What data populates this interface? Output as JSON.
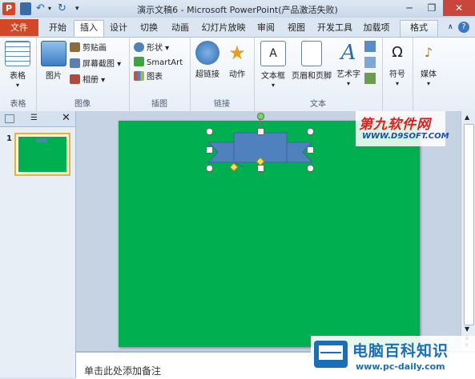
{
  "window": {
    "title": "演示文稿6 - Microsoft PowerPoint(产品激活失败)"
  },
  "tabs": [
    "开始",
    "插入",
    "设计",
    "切换",
    "动画",
    "幻灯片放映",
    "审阅",
    "视图",
    "开发工具",
    "加载项"
  ],
  "file_tab": "文件",
  "format_tab": "格式",
  "ribbon": {
    "table": {
      "label": "表格",
      "group": "表格"
    },
    "image_group": {
      "picture": "图片",
      "clipart": "剪贴画",
      "screenshot": "屏幕截图",
      "album": "相册",
      "group": "图像"
    },
    "illustration_group": {
      "shapes": "形状",
      "smartart": "SmartArt",
      "chart": "图表",
      "group": "插图"
    },
    "link_group": {
      "hyperlink": "超链接",
      "action": "动作",
      "group": "链接"
    },
    "text_group": {
      "textbox": "文本框",
      "header_footer": "页眉和页脚",
      "wordart": "艺术字",
      "group": "文本"
    },
    "symbol": {
      "label": "符号"
    },
    "media": {
      "label": "媒体"
    }
  },
  "slide_panel": {
    "slide_number": "1"
  },
  "notes": {
    "placeholder": "单击此处添加备注"
  },
  "watermarks": {
    "top_cn": "第九软件网",
    "top_url": "WWW.D9SOFT.COM",
    "bottom_cn": "电脑百科知识",
    "bottom_url": "www.pc-daily.com"
  },
  "colors": {
    "slide_bg": "#00b050",
    "ribbon_shape": "#4f81bd",
    "file_tab": "#d24726"
  }
}
